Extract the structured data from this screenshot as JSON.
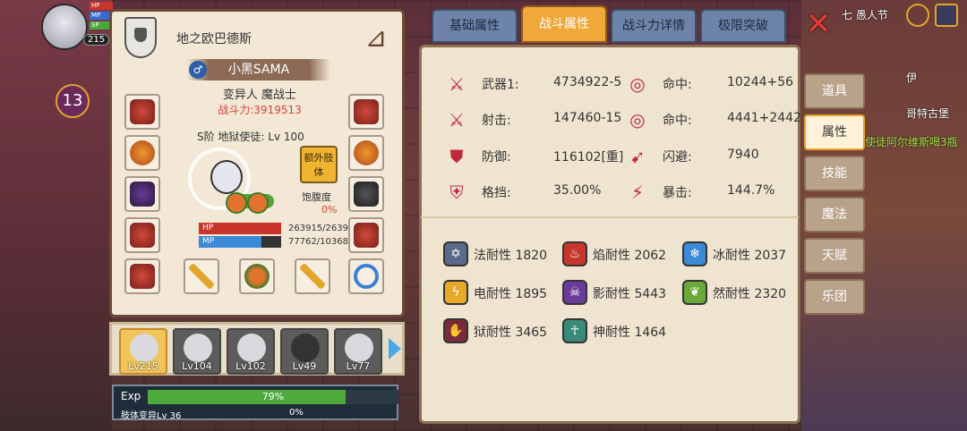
{
  "hud": {
    "level": "215",
    "bars": [
      "HP",
      "MP",
      "SP"
    ],
    "notification": "13"
  },
  "character": {
    "title": "地之欧巴德斯",
    "name": "小黑SAMA",
    "gender_symbol": "♂",
    "class": "变异人 魔战士",
    "power": "战斗力:3919513",
    "rank": "S阶 地狱使徒: Lv 100",
    "extra_button": "额外肢体",
    "satiety_label": "饱腹度",
    "satiety_value": "0%",
    "hp_label": "HP",
    "hp_value": "263915/2639",
    "mp_label": "MP",
    "mp_value": "77762/10368"
  },
  "party": {
    "members": [
      {
        "lv": "Lv215"
      },
      {
        "lv": "Lv104"
      },
      {
        "lv": "Lv102"
      },
      {
        "lv": "Lv49"
      },
      {
        "lv": "Lv77"
      }
    ]
  },
  "exp": {
    "label": "Exp",
    "percent": "79%",
    "percent_value": 79,
    "sub_label": "肢体变异Lv 36",
    "sub_percent": "0%"
  },
  "tabs": [
    {
      "label": "基础属性"
    },
    {
      "label": "战斗属性"
    },
    {
      "label": "战斗力详情"
    },
    {
      "label": "极限突破"
    }
  ],
  "combat": {
    "left": [
      {
        "label": "武器1:",
        "value": "4734922-5"
      },
      {
        "label": "射击:",
        "value": "147460-15"
      },
      {
        "label": "防御:",
        "value": "116102[重]"
      },
      {
        "label": "格挡:",
        "value": "35.00%"
      }
    ],
    "right": [
      {
        "label": "命中:",
        "value": "10244+56"
      },
      {
        "label": "命中:",
        "value": "4441+2442"
      },
      {
        "label": "闪避:",
        "value": "7940"
      },
      {
        "label": "暴击:",
        "value": "144.7%"
      }
    ]
  },
  "resistances": [
    {
      "label": "法耐性 1820",
      "color": "#5a6a8a"
    },
    {
      "label": "焰耐性 2062",
      "color": "#c8352a"
    },
    {
      "label": "冰耐性 2037",
      "color": "#3a8ad8"
    },
    {
      "label": "电耐性 1895",
      "color": "#e8a828"
    },
    {
      "label": "影耐性 5443",
      "color": "#6a3a9a"
    },
    {
      "label": "然耐性 2320",
      "color": "#6aa83a"
    },
    {
      "label": "狱耐性 3465",
      "color": "#7a2a3a"
    },
    {
      "label": "神耐性 1464",
      "color": "#3a8a7a"
    }
  ],
  "side_menu": [
    {
      "label": "道具"
    },
    {
      "label": "属性"
    },
    {
      "label": "技能"
    },
    {
      "label": "魔法"
    },
    {
      "label": "天赋"
    },
    {
      "label": "乐团"
    }
  ],
  "top_right": {
    "text": "七 愚人节"
  },
  "scene_text": {
    "npc1": "伊",
    "npc2": "哥特古堡",
    "npc3": "使徒阿尔维斯喝3瓶"
  }
}
